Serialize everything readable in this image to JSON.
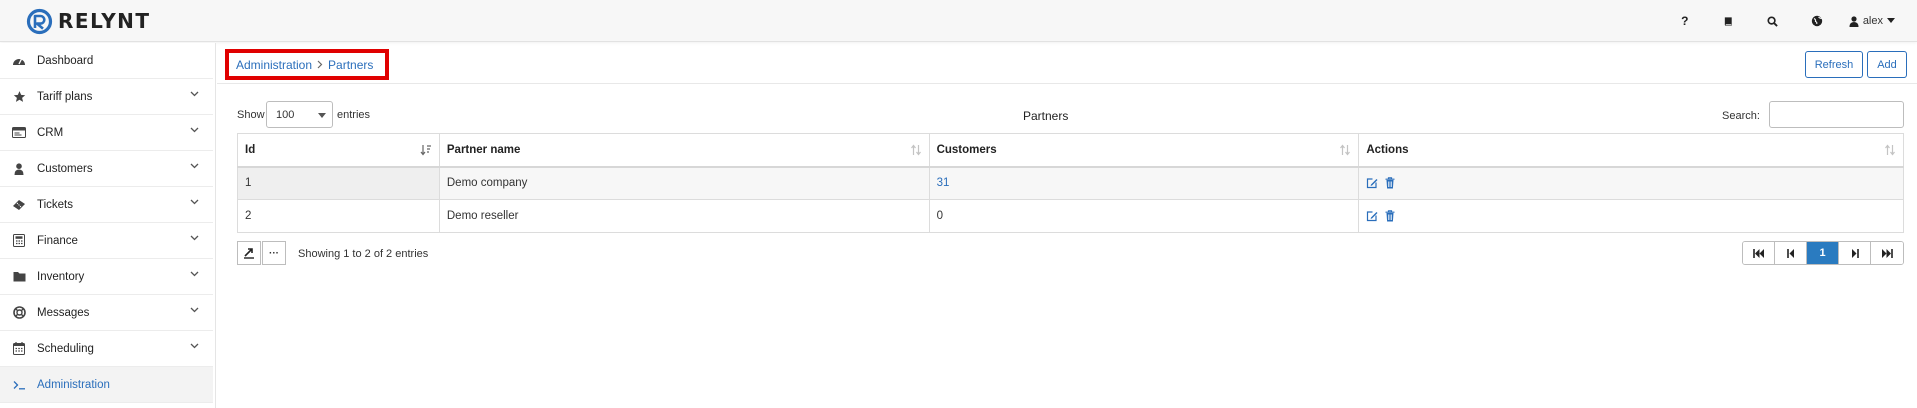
{
  "app": {
    "logo_text": "RELYNT",
    "brand_color": "#2a6ebb"
  },
  "topbar": {
    "icons": [
      "help-icon",
      "book-icon",
      "search-icon",
      "globe-icon"
    ],
    "help_label": "?",
    "user": "alex"
  },
  "sidebar": {
    "items": [
      {
        "label": "Dashboard",
        "icon": "dashboard-icon"
      },
      {
        "label": "Tariff plans",
        "icon": "star-icon"
      },
      {
        "label": "CRM",
        "icon": "crm-icon"
      },
      {
        "label": "Customers",
        "icon": "user-icon"
      },
      {
        "label": "Tickets",
        "icon": "ticket-icon"
      },
      {
        "label": "Finance",
        "icon": "finance-icon"
      },
      {
        "label": "Inventory",
        "icon": "folder-icon"
      },
      {
        "label": "Messages",
        "icon": "lifebuoy-icon"
      },
      {
        "label": "Scheduling",
        "icon": "calendar-icon"
      },
      {
        "label": "Administration",
        "icon": "terminal-icon"
      }
    ]
  },
  "breadcrumb": {
    "parent": "Administration",
    "current": "Partners"
  },
  "toolbar": {
    "refresh_label": "Refresh",
    "add_label": "Add"
  },
  "table_controls": {
    "show_label": "Show",
    "entries_value": "100",
    "entries_label": "entries",
    "title": "Partners",
    "search_label": "Search:",
    "search_value": ""
  },
  "table": {
    "columns": [
      "Id",
      "Partner name",
      "Customers",
      "Actions"
    ],
    "rows": [
      {
        "id": "1",
        "name": "Demo company",
        "customers": "31"
      },
      {
        "id": "2",
        "name": "Demo reseller",
        "customers": "0"
      }
    ]
  },
  "footer": {
    "showing": "Showing 1 to 2 of 2 entries",
    "more_label": "···",
    "current_page": "1"
  }
}
